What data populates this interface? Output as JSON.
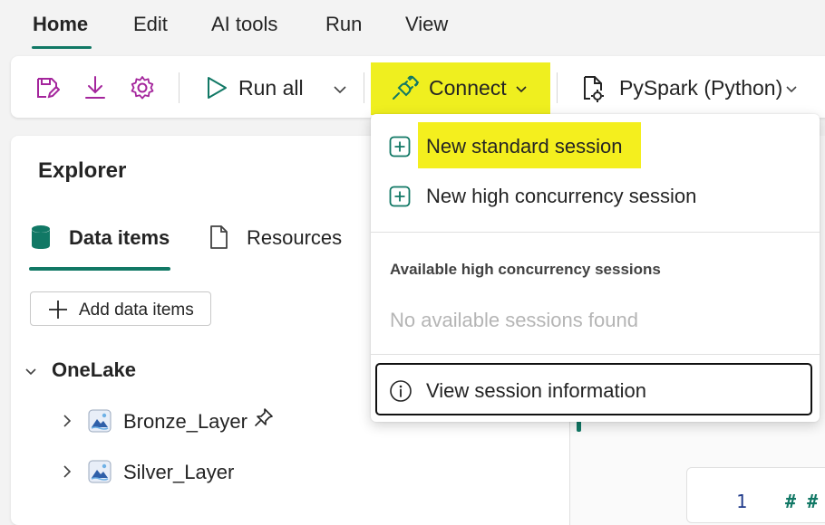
{
  "menu": {
    "tabs": [
      "Home",
      "Edit",
      "AI tools",
      "Run",
      "View"
    ],
    "active": "Home"
  },
  "toolbar": {
    "save_icon": "save-edit-icon",
    "download_icon": "download-icon",
    "settings_icon": "gear-icon",
    "run_all_label": "Run all",
    "connect_label": "Connect",
    "language_label": "PySpark (Python)"
  },
  "explorer": {
    "title": "Explorer",
    "tabs": [
      {
        "label": "Data items",
        "icon": "database-icon"
      },
      {
        "label": "Resources",
        "icon": "document-icon"
      }
    ],
    "add_button": "Add data items",
    "tree": {
      "root": "OneLake",
      "items": [
        "Bronze_Layer",
        "Silver_Layer"
      ]
    }
  },
  "connect_menu": {
    "items": [
      {
        "label": "New standard session",
        "icon": "add-square-icon"
      },
      {
        "label": "New high concurrency session",
        "icon": "add-square-icon"
      }
    ],
    "section_title": "Available high concurrency sessions",
    "empty_text": "No available sessions found",
    "info_item": {
      "label": "View session information",
      "icon": "info-icon"
    }
  },
  "editor": {
    "line_number": "1",
    "code": "# #"
  },
  "colors": {
    "accent": "#117865",
    "highlight": "#efef1f",
    "icon_purple": "#a4259c",
    "icon_teal": "#117865"
  }
}
